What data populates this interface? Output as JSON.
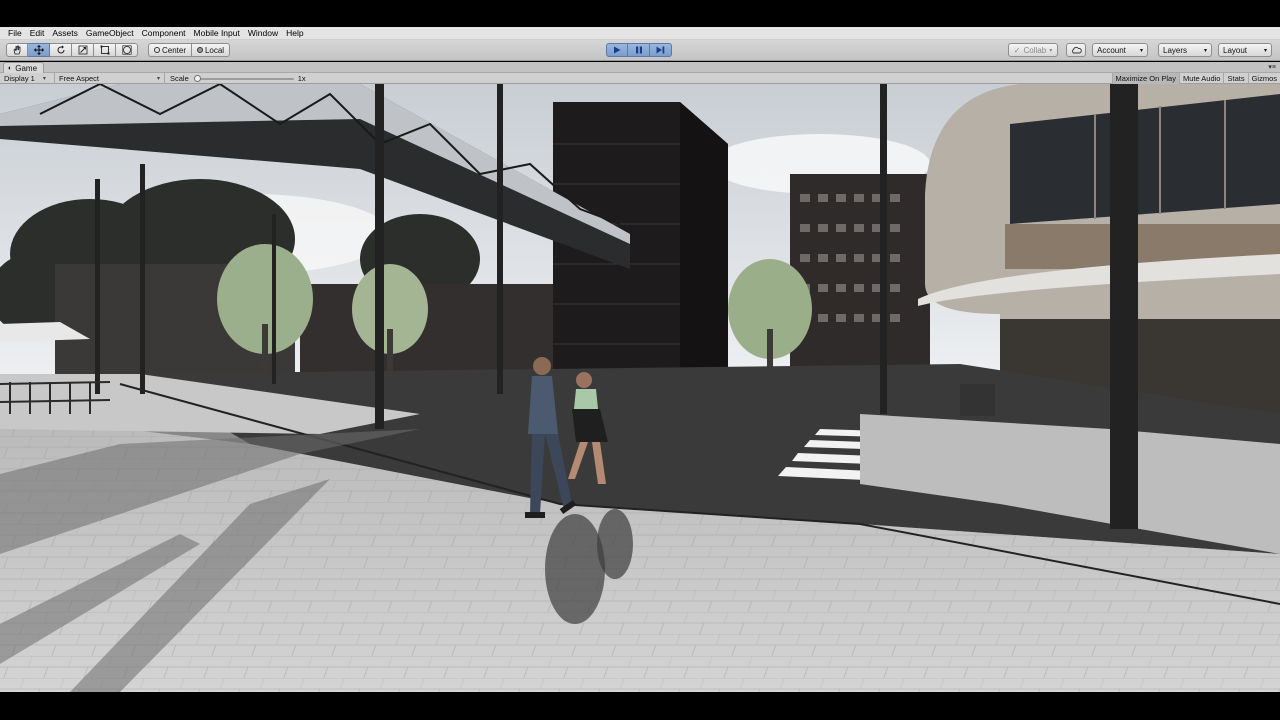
{
  "menu": [
    "File",
    "Edit",
    "Assets",
    "GameObject",
    "Component",
    "Mobile Input",
    "Window",
    "Help"
  ],
  "toolbar": {
    "transform_tools": [
      "hand-tool-icon",
      "move-tool-icon",
      "rotate-tool-icon",
      "scale-tool-icon",
      "rect-tool-icon",
      "transform-tool-icon"
    ],
    "pivot_mode": "Center",
    "pivot_rotation": "Local",
    "playback": [
      "play-icon",
      "pause-icon",
      "step-icon"
    ],
    "collab": "Collab",
    "account": "Account",
    "layers": "Layers",
    "layout": "Layout"
  },
  "game_tab": {
    "title": "Game",
    "display": "Display 1",
    "aspect": "Free Aspect",
    "scale_label": "Scale",
    "scale_value": "1x",
    "toggles": [
      "Maximize On Play",
      "Mute Audio",
      "Stats",
      "Gizmos"
    ],
    "maximize_on_play_active": true
  },
  "scene": {
    "description_icon": "city-street-scene",
    "sky_color": "#dfe3e8",
    "pavement_color": "#c9c9c9",
    "road_color": "#3a3a3a"
  },
  "colors": {
    "play_active": "#7c9ccc",
    "toolbar_bg": "#c8c8c8",
    "menubar_bg": "#e4e4e4"
  }
}
